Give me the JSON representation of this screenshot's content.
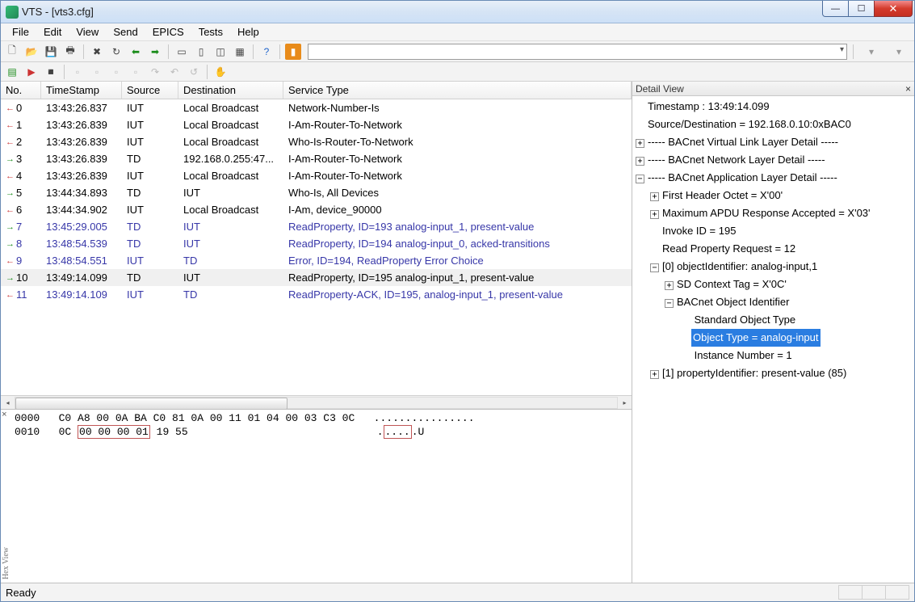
{
  "window": {
    "title": "VTS - [vts3.cfg]"
  },
  "menu": [
    "File",
    "Edit",
    "View",
    "Send",
    "EPICS",
    "Tests",
    "Help"
  ],
  "toolbar1_icons": [
    "new",
    "open",
    "save",
    "print",
    "|",
    "delete",
    "refresh",
    "back",
    "forward",
    "|",
    "tile1",
    "tile2",
    "tile3",
    "tile4",
    "|",
    "help",
    "|",
    "orange"
  ],
  "columns": {
    "no": "No.",
    "ts": "TimeStamp",
    "src": "Source",
    "dst": "Destination",
    "svc": "Service Type"
  },
  "packets": [
    {
      "dir": "out",
      "no": "0",
      "ts": "13:43:26.837",
      "src": "IUT",
      "dst": "Local Broadcast",
      "svc": "Network-Number-Is",
      "col": ""
    },
    {
      "dir": "out",
      "no": "1",
      "ts": "13:43:26.839",
      "src": "IUT",
      "dst": "Local Broadcast",
      "svc": "I-Am-Router-To-Network",
      "col": ""
    },
    {
      "dir": "out",
      "no": "2",
      "ts": "13:43:26.839",
      "src": "IUT",
      "dst": "Local Broadcast",
      "svc": "Who-Is-Router-To-Network",
      "col": ""
    },
    {
      "dir": "in",
      "no": "3",
      "ts": "13:43:26.839",
      "src": "TD",
      "dst": "192.168.0.255:47...",
      "svc": "I-Am-Router-To-Network",
      "col": ""
    },
    {
      "dir": "out",
      "no": "4",
      "ts": "13:43:26.839",
      "src": "IUT",
      "dst": "Local Broadcast",
      "svc": "I-Am-Router-To-Network",
      "col": ""
    },
    {
      "dir": "in",
      "no": "5",
      "ts": "13:44:34.893",
      "src": "TD",
      "dst": "IUT",
      "svc": "Who-Is, All Devices",
      "col": ""
    },
    {
      "dir": "out",
      "no": "6",
      "ts": "13:44:34.902",
      "src": "IUT",
      "dst": "Local Broadcast",
      "svc": "I-Am, device_90000",
      "col": ""
    },
    {
      "dir": "in",
      "no": "7",
      "ts": "13:45:29.005",
      "src": "TD",
      "dst": "IUT",
      "svc": "ReadProperty, ID=193 analog-input_1, present-value",
      "col": "p"
    },
    {
      "dir": "in",
      "no": "8",
      "ts": "13:48:54.539",
      "src": "TD",
      "dst": "IUT",
      "svc": "ReadProperty, ID=194 analog-input_0, acked-transitions",
      "col": "p"
    },
    {
      "dir": "out",
      "no": "9",
      "ts": "13:48:54.551",
      "src": "IUT",
      "dst": "TD",
      "svc": "Error, ID=194, ReadProperty Error Choice",
      "col": "p"
    },
    {
      "dir": "in",
      "no": "10",
      "ts": "13:49:14.099",
      "src": "TD",
      "dst": "IUT",
      "svc": "ReadProperty, ID=195 analog-input_1, present-value",
      "col": "",
      "sel": true
    },
    {
      "dir": "out",
      "no": "11",
      "ts": "13:49:14.109",
      "src": "IUT",
      "dst": "TD",
      "svc": "ReadProperty-ACK, ID=195, analog-input_1, present-value",
      "col": "p"
    }
  ],
  "detail": {
    "title": "Detail View",
    "lines": [
      {
        "l": 0,
        "exp": "",
        "t": "Timestamp : 13:49:14.099"
      },
      {
        "l": 0,
        "exp": "",
        "t": "Source/Destination       = 192.168.0.10:0xBAC0"
      },
      {
        "l": 0,
        "exp": "+",
        "t": "----- BACnet Virtual Link Layer Detail -----"
      },
      {
        "l": 0,
        "exp": "+",
        "t": "----- BACnet Network Layer Detail -----"
      },
      {
        "l": 0,
        "exp": "-",
        "t": "----- BACnet Application Layer Detail -----"
      },
      {
        "l": 1,
        "exp": "+",
        "t": "First Header Octet          = X'00'"
      },
      {
        "l": 1,
        "exp": "+",
        "t": "Maximum APDU Response Accepted = X'03'"
      },
      {
        "l": 1,
        "exp": "",
        "t": "Invoke ID               = 195"
      },
      {
        "l": 1,
        "exp": "",
        "t": "Read Property Request      = 12"
      },
      {
        "l": 1,
        "exp": "-",
        "t": "[0] objectIdentifier:  analog-input,1"
      },
      {
        "l": 2,
        "exp": "+",
        "t": "SD Context Tag               = X'0C'"
      },
      {
        "l": 2,
        "exp": "-",
        "t": "BACnet Object Identifier"
      },
      {
        "l": 3,
        "exp": "",
        "t": "           Standard Object Type"
      },
      {
        "l": 3,
        "exp": "",
        "t": "           Object Type = analog-input",
        "sel": true
      },
      {
        "l": 3,
        "exp": "",
        "t": "           Instance Number = 1"
      },
      {
        "l": 1,
        "exp": "+",
        "t": "[1] propertyIdentifier:  present-value (85)"
      }
    ]
  },
  "hex": {
    "label": "Hex View",
    "line1_off": "0000",
    "line1_a": "C0 A8 00 0A BA C0 81 0A 00 11 01 04 00 03 C3 0C",
    "line1_b": "................",
    "line2_off": "0010",
    "line2_a": "0C ",
    "line2_hl": "00 00 00 01",
    "line2_a2": " 19 55",
    "line2_b": ".",
    "line2_hlb": "....",
    "line2_b2": ".U"
  },
  "status": "Ready"
}
